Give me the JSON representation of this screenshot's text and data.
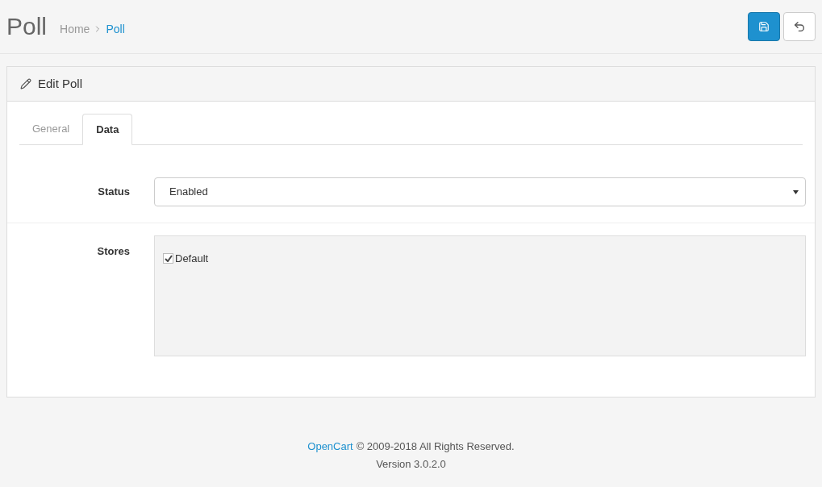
{
  "header": {
    "title": "Poll",
    "breadcrumbs": [
      {
        "label": "Home",
        "selected": false
      },
      {
        "label": "Poll",
        "selected": true
      }
    ]
  },
  "panel": {
    "title": "Edit Poll",
    "tabs": [
      {
        "label": "General",
        "selected": false
      },
      {
        "label": "Data",
        "selected": true
      }
    ],
    "status": {
      "label": "Status",
      "value": "Enabled"
    },
    "stores": {
      "label": "Stores",
      "items": [
        {
          "label": "Default",
          "checked": true
        }
      ]
    }
  },
  "footer": {
    "link": "OpenCart",
    "text": "© 2009-2018 All Rights Reserved.",
    "version": "Version 3.0.2.0"
  }
}
